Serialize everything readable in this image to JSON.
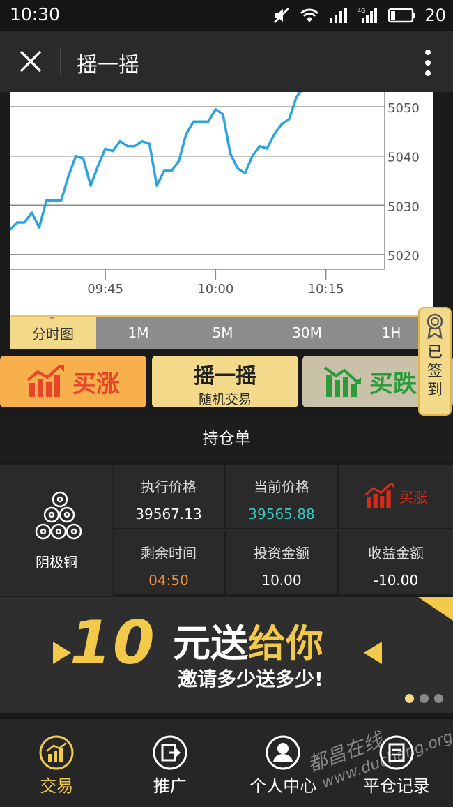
{
  "status": {
    "time": "10:30",
    "battery": "20",
    "net": "4G"
  },
  "titlebar": {
    "title": "摇一摇"
  },
  "chart_data": {
    "type": "line",
    "x_ticks": [
      "09:45",
      "10:00",
      "10:15"
    ],
    "y_ticks": [
      5020,
      5030,
      5040,
      5050
    ],
    "ylim": [
      5017,
      5053
    ],
    "grid": "horizontal",
    "series": [
      {
        "values": [
          [
            "09:32",
            5025
          ],
          [
            "09:33",
            5026.5
          ],
          [
            "09:34",
            5026.5
          ],
          [
            "09:35",
            5028.5
          ],
          [
            "09:36",
            5025.5
          ],
          [
            "09:37",
            5031
          ],
          [
            "09:38",
            5031
          ],
          [
            "09:39",
            5031
          ],
          [
            "09:40",
            5036
          ],
          [
            "09:41",
            5040
          ],
          [
            "09:42",
            5039.5
          ],
          [
            "09:43",
            5034
          ],
          [
            "09:44",
            5038
          ],
          [
            "09:45",
            5041.5
          ],
          [
            "09:46",
            5041
          ],
          [
            "09:47",
            5043
          ],
          [
            "09:48",
            5042
          ],
          [
            "09:49",
            5042
          ],
          [
            "09:50",
            5043
          ],
          [
            "09:51",
            5042.5
          ],
          [
            "09:52",
            5034
          ],
          [
            "09:53",
            5037
          ],
          [
            "09:54",
            5037
          ],
          [
            "09:55",
            5039
          ],
          [
            "09:56",
            5044.5
          ],
          [
            "09:57",
            5047
          ],
          [
            "09:58",
            5047
          ],
          [
            "09:59",
            5047
          ],
          [
            "10:00",
            5049.5
          ],
          [
            "10:01",
            5048.5
          ],
          [
            "10:02",
            5040.5
          ],
          [
            "10:03",
            5037.5
          ],
          [
            "10:04",
            5036.5
          ],
          [
            "10:05",
            5040
          ],
          [
            "10:06",
            5042
          ],
          [
            "10:07",
            5041.5
          ],
          [
            "10:08",
            5044.5
          ],
          [
            "10:09",
            5046.5
          ],
          [
            "10:10",
            5047.5
          ],
          [
            "10:11",
            5052
          ],
          [
            "10:12",
            5054
          ]
        ],
        "color": "#2aa3de"
      }
    ]
  },
  "timeframes": [
    "分时图",
    "1M",
    "5M",
    "30M",
    "1H"
  ],
  "actions": {
    "buy_up": "买涨",
    "shake_l1": "摇一摇",
    "shake_l2": "随机交易",
    "buy_down": "买跌"
  },
  "signin": {
    "chars": [
      "已",
      "签",
      "到"
    ]
  },
  "position": {
    "title": "持仓单",
    "asset": "阴极铜",
    "exec_price_k": "执行价格",
    "exec_price_v": "39567.13",
    "cur_price_k": "当前价格",
    "cur_price_v": "39565.88",
    "direction": "买涨",
    "remain_k": "剩余时间",
    "remain_v": "04:50",
    "invest_k": "投资金额",
    "invest_v": "10.00",
    "profit_k": "收益金额",
    "profit_v": "-10.00",
    "colors": {
      "cur_price": "#38c9c0",
      "remain": "#f0903a",
      "direction": "#d42a1a"
    }
  },
  "banner": {
    "big": "10",
    "hdr_a": "元送",
    "hdr_b": "给你",
    "sub": "邀请多少送多少!"
  },
  "nav": [
    {
      "label": "交易",
      "icon": "chart-icon",
      "active": true
    },
    {
      "label": "推广",
      "icon": "share-icon"
    },
    {
      "label": "个人中心",
      "icon": "user-icon"
    },
    {
      "label": "平仓记录",
      "icon": "record-icon"
    }
  ],
  "watermark": {
    "line1": "都昌在线",
    "line2": "www.duchang.org"
  }
}
